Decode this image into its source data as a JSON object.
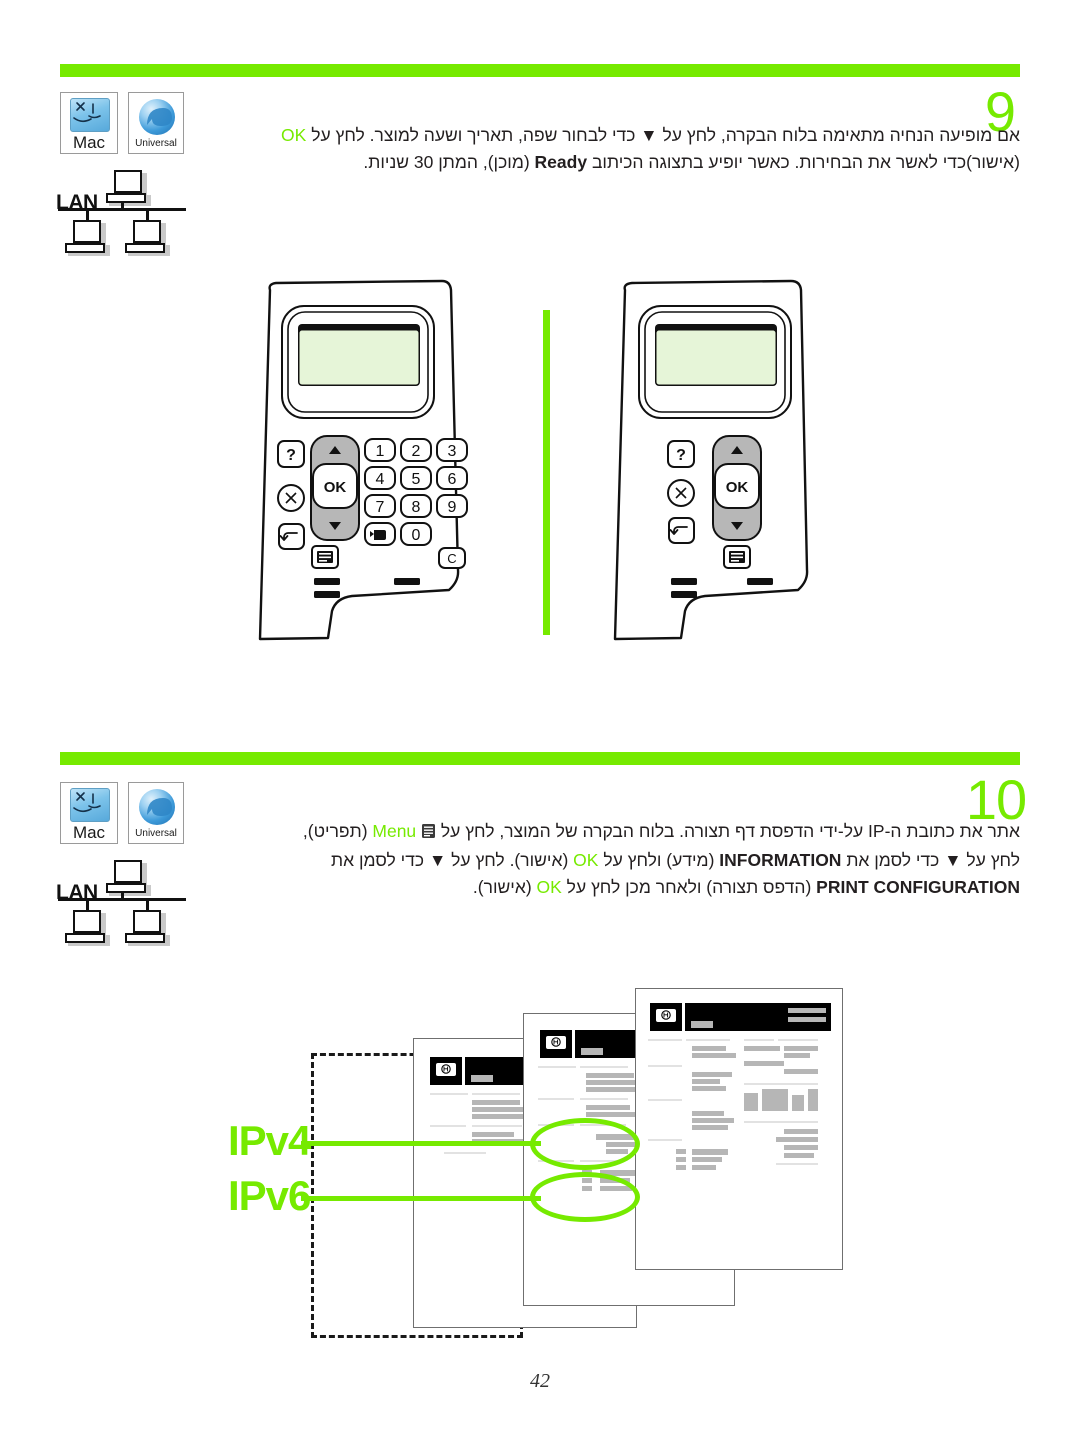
{
  "page": {
    "number": "42",
    "accent_color": "#76ea00",
    "text_color": "#231f20"
  },
  "steps": [
    {
      "number": "9",
      "platform_icons": [
        {
          "name": "Mac",
          "label": "Mac"
        },
        {
          "name": "Universal",
          "label": "Universal"
        }
      ],
      "connection_label": "LAN",
      "text_line1_a": "אם מופיעה הנחיה מתאימה בלוח הבקרה, לחץ על ",
      "text_line1_arrow": "▼",
      "text_line1_b": " כדי לבחור שפה, תאריך ושעה למוצר. לחץ על ",
      "text_line1_ok": "OK",
      "text_line1_c": " (אישור)",
      "text_line2_a": "כדי לאשר  את הבחירות. כאשר יופיע בתצוגה הכיתוב ",
      "text_line2_bold": "Ready",
      "text_line2_b": " (מוכן), המתן 30 שניות."
    },
    {
      "number": "10",
      "platform_icons": [
        {
          "name": "Mac",
          "label": "Mac"
        },
        {
          "name": "Universal",
          "label": "Universal"
        }
      ],
      "connection_label": "LAN",
      "text_line1_a": "אתר את כתובת ה-IP על-ידי הדפסת דף תצורה. בלוח הבקרה של המוצר, לחץ על ",
      "text_line1_menu": "Menu",
      "text_line1_b": " (תפריט),",
      "text_line2_a": "לחץ על ",
      "text_line2_arrow": "▼",
      "text_line2_b": " כדי לסמן את ",
      "text_line2_bold": "INFORMATION",
      "text_line2_c": " (מידע) ולחץ על ",
      "text_line2_ok": "OK",
      "text_line2_d": " (אישור). לחץ על ",
      "text_line2_arrow2": "▼",
      "text_line2_e": " כדי לסמן את",
      "text_line3_bold": "PRINT CONFIGURATION",
      "text_line3_a": " (הדפס תצורה) ולאחר מכן לחץ על ",
      "text_line3_ok": "OK",
      "text_line3_b": " (אישור)."
    }
  ],
  "control_panels": [
    {
      "id": "panel-with-keypad",
      "keys": [
        "?",
        "⊗",
        "↰",
        "OK",
        "▲",
        "▼",
        "menu",
        "1",
        "2",
        "3",
        "4",
        "5",
        "6",
        "7",
        "8",
        "9",
        "0",
        "folder",
        "C"
      ],
      "keypad_digits": [
        "1",
        "2",
        "3",
        "4",
        "5",
        "6",
        "7",
        "8",
        "9"
      ],
      "zero_key": "0",
      "clear_key": "C",
      "ok_key": "OK",
      "help_key": "?",
      "leds": 3
    },
    {
      "id": "panel-no-keypad",
      "keys": [
        "?",
        "⊗",
        "↰",
        "OK",
        "▲",
        "▼",
        "menu"
      ],
      "ok_key": "OK",
      "help_key": "?",
      "leds": 3
    }
  ],
  "callouts": [
    {
      "label": "IPv4"
    },
    {
      "label": "IPv6"
    }
  ]
}
